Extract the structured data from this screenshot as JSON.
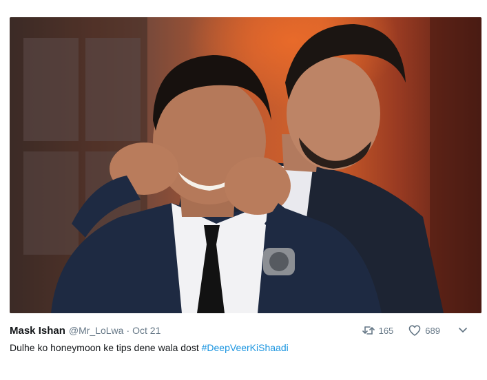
{
  "tweet": {
    "author_name": "Mask Ishan",
    "handle": "@Mr_LoLwa",
    "separator": "·",
    "date": "Oct 21",
    "text": "Dulhe ko honeymoon ke tips dene wala dost",
    "hashtag": "#DeepVeerKiShaadi",
    "retweet_count": "165",
    "like_count": "689"
  },
  "icons": {
    "retweet": "retweet-icon",
    "like": "heart-icon",
    "more": "chevron-down-icon"
  },
  "colors": {
    "hashtag": "#1b95e0",
    "muted": "#657786",
    "text": "#14171a"
  }
}
